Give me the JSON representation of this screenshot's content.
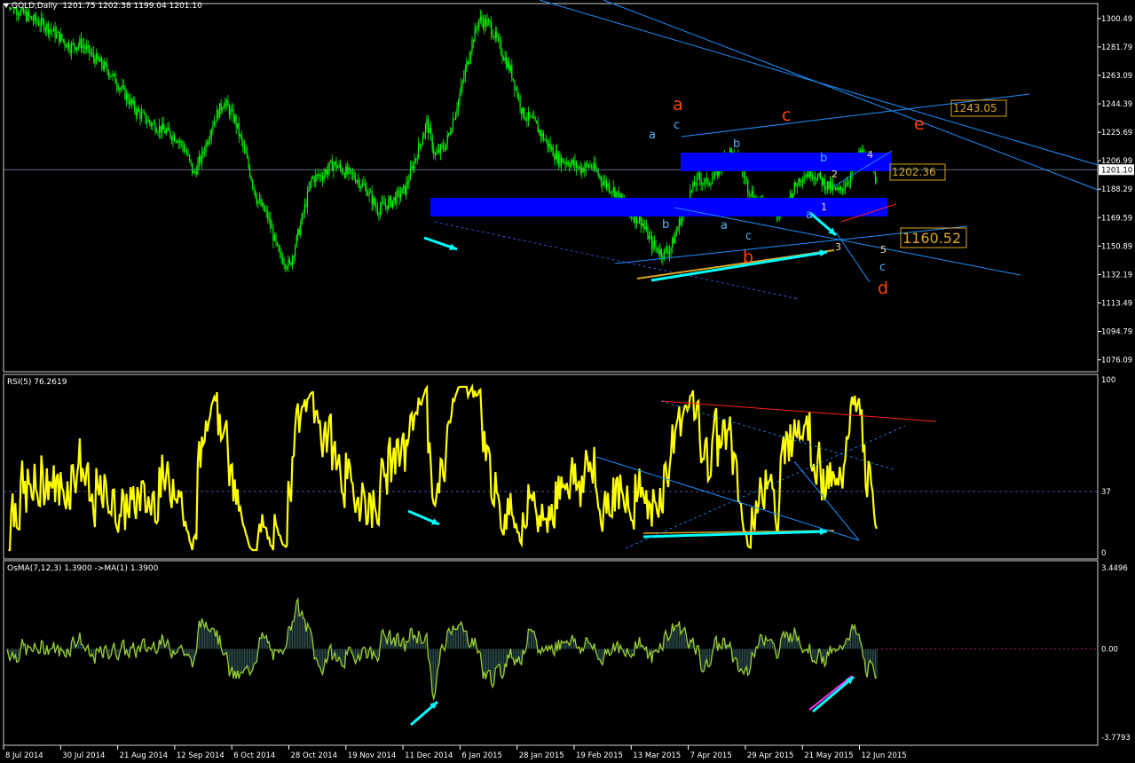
{
  "window": {
    "title": "GOLD,Daily",
    "ohlc": "1201.75 1202.38 1199.04 1201.10",
    "rsi_title": "RSI(5) 76.2619",
    "osma_title": "OsMA(7,12,3) 1.3900 ->MA(1) 1.3900"
  },
  "colors": {
    "background": "#000000",
    "grid_border": "#ffffff",
    "candles": "#00ff00",
    "rsi_line": "#ffff00",
    "osma_fill": "#2f4f4f",
    "osma_line": "#9acd32",
    "channel_lines": "#1e90ff",
    "zones": "#0000ff",
    "arrows": "#00ffff",
    "wave_red": "#ff4500",
    "wave_blue": "#1e90ff",
    "price_label": "#daa520"
  },
  "chart_data": [
    {
      "type": "candlestick",
      "symbol": "GOLD",
      "timeframe": "Daily",
      "ylim": [
        1070.0,
        1308.0
      ],
      "yticks": [
        "1300.49",
        "1281.79",
        "1263.09",
        "1244.39",
        "1225.69",
        "1206.99",
        "1188.29",
        "1169.59",
        "1150.89",
        "1132.19",
        "1113.49",
        "1094.79",
        "1076.09"
      ],
      "xticks": [
        "8 Jul 2014",
        "30 Jul 2014",
        "21 Aug 2014",
        "12 Sep 2014",
        "6 Oct 2014",
        "28 Oct 2014",
        "19 Nov 2014",
        "11 Dec 2014",
        "6 Jan 2015",
        "28 Jan 2015",
        "19 Feb 2015",
        "13 Mar 2015",
        "7 Apr 2015",
        "29 Apr 2015",
        "21 May 2015",
        "12 Jun 2015"
      ],
      "price_path": [
        [
          0,
          1316
        ],
        [
          8,
          1306
        ],
        [
          18,
          1300
        ],
        [
          28,
          1296
        ],
        [
          36,
          1290
        ],
        [
          46,
          1282
        ],
        [
          54,
          1284
        ],
        [
          62,
          1276
        ],
        [
          74,
          1266
        ],
        [
          82,
          1256
        ],
        [
          94,
          1240
        ],
        [
          104,
          1232
        ],
        [
          112,
          1228
        ],
        [
          124,
          1222
        ],
        [
          130,
          1214
        ],
        [
          136,
          1198
        ],
        [
          142,
          1210
        ],
        [
          150,
          1232
        ],
        [
          158,
          1246
        ],
        [
          166,
          1234
        ],
        [
          174,
          1210
        ],
        [
          182,
          1182
        ],
        [
          190,
          1170
        ],
        [
          198,
          1145
        ],
        [
          206,
          1138
        ],
        [
          214,
          1165
        ],
        [
          222,
          1195
        ],
        [
          230,
          1198
        ],
        [
          238,
          1205
        ],
        [
          246,
          1200
        ],
        [
          254,
          1196
        ],
        [
          262,
          1188
        ],
        [
          270,
          1175
        ],
        [
          280,
          1180
        ],
        [
          290,
          1188
        ],
        [
          300,
          1215
        ],
        [
          306,
          1232
        ],
        [
          312,
          1210
        ],
        [
          320,
          1218
        ],
        [
          330,
          1250
        ],
        [
          338,
          1282
        ],
        [
          344,
          1300
        ],
        [
          352,
          1296
        ],
        [
          360,
          1280
        ],
        [
          368,
          1264
        ],
        [
          376,
          1238
        ],
        [
          384,
          1232
        ],
        [
          394,
          1218
        ],
        [
          402,
          1208
        ],
        [
          410,
          1206
        ],
        [
          418,
          1202
        ],
        [
          426,
          1204
        ],
        [
          434,
          1194
        ],
        [
          444,
          1186
        ],
        [
          454,
          1172
        ],
        [
          462,
          1168
        ],
        [
          470,
          1152
        ],
        [
          478,
          1146
        ],
        [
          484,
          1150
        ],
        [
          490,
          1166
        ],
        [
          496,
          1182
        ],
        [
          504,
          1196
        ],
        [
          510,
          1192
        ],
        [
          518,
          1200
        ],
        [
          526,
          1214
        ],
        [
          534,
          1205
        ],
        [
          540,
          1190
        ],
        [
          548,
          1178
        ],
        [
          556,
          1181
        ],
        [
          562,
          1170
        ],
        [
          570,
          1182
        ],
        [
          578,
          1196
        ],
        [
          586,
          1200
        ],
        [
          596,
          1192
        ],
        [
          606,
          1186
        ],
        [
          614,
          1196
        ],
        [
          622,
          1213
        ],
        [
          628,
          1206
        ],
        [
          634,
          1195
        ]
      ],
      "current_price": "1201.10",
      "price_labels": [
        "1243.05",
        "1202.36",
        "1160.52"
      ],
      "wave_labels_red": [
        "a",
        "c",
        "b",
        "e",
        "d"
      ],
      "wave_labels_blue": [
        "a",
        "c",
        "b",
        "b",
        "a",
        "c",
        "b",
        "a",
        "c"
      ],
      "wave_labels_yellow": [
        "4",
        "2",
        "1",
        "3",
        "5"
      ]
    },
    {
      "type": "line",
      "name": "RSI(5)",
      "ylim": [
        0,
        100
      ],
      "yticks": [
        "100",
        "37",
        "0"
      ],
      "last_value": 76.2619
    },
    {
      "type": "bar",
      "name": "OsMA(7,12,3)",
      "ylim": [
        -3.7793,
        3.4496
      ],
      "yticks": [
        "3.4496",
        "0.00",
        "-3.7793"
      ],
      "last_value": 1.39
    }
  ]
}
